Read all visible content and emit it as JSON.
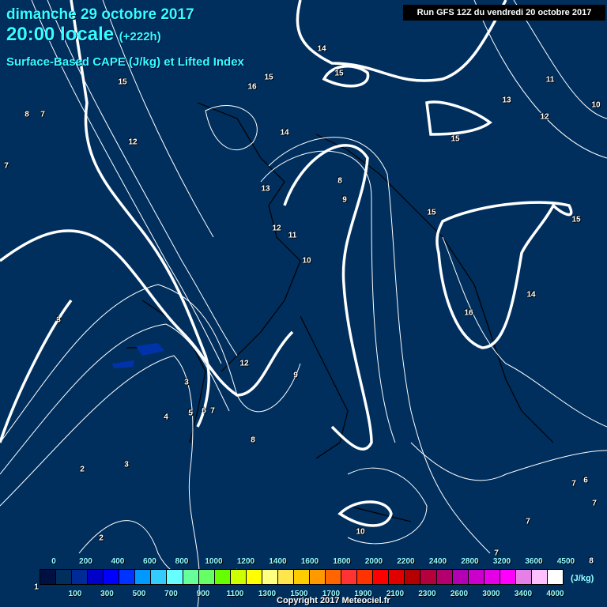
{
  "header": {
    "date": "dimanche 29 octobre 2017",
    "time": "20:00 locale",
    "offset": "(+222h)",
    "product": "Surface-Based CAPE (J/kg) et Lifted Index",
    "run": "Run GFS 12Z du vendredi 20 octobre 2017"
  },
  "lifted_index_labels": [
    "15",
    "14",
    "15",
    "16",
    "11",
    "10",
    "13",
    "12",
    "15",
    "15",
    "8",
    "7",
    "12",
    "7",
    "8",
    "13",
    "12",
    "8",
    "9",
    "15",
    "15",
    "14",
    "11",
    "12",
    "10",
    "14",
    "16",
    "3",
    "12",
    "9",
    "3",
    "4",
    "5",
    "6",
    "7",
    "8",
    "2",
    "3",
    "2",
    "10",
    "7",
    "7",
    "6",
    "7",
    "7",
    "8",
    "1"
  ],
  "legend": {
    "top_labels": [
      "0",
      "200",
      "400",
      "600",
      "800",
      "1000",
      "1200",
      "1400",
      "1600",
      "1800",
      "2000",
      "2200",
      "2400",
      "2800",
      "3200",
      "3600",
      "4500"
    ],
    "bottom_labels": [
      "100",
      "300",
      "500",
      "700",
      "900",
      "1100",
      "1300",
      "1500",
      "1700",
      "1900",
      "2100",
      "2300",
      "2600",
      "3000",
      "3400",
      "4000"
    ],
    "unit": "(J/kg)",
    "colors": [
      "#001040",
      "#002f5e",
      "#002a96",
      "#0000c8",
      "#0000ff",
      "#0033ff",
      "#0099ff",
      "#33ccff",
      "#66ffff",
      "#66ff99",
      "#66ff66",
      "#66ff00",
      "#ccff00",
      "#ffff00",
      "#ffff80",
      "#ffe64d",
      "#ffcc00",
      "#ff9900",
      "#ff6600",
      "#ff3333",
      "#ff3300",
      "#ff0000",
      "#e00000",
      "#b40000",
      "#b4003c",
      "#b4006e",
      "#b400b4",
      "#cc00cc",
      "#e600e6",
      "#ff00ff",
      "#e680e6",
      "#ffc0ff",
      "#ffffff"
    ]
  },
  "copyright": "Copyright 2017 Meteociel.fr",
  "colors": {
    "background": "#002f5e",
    "title": "#33ffff",
    "contour": "#ffffff",
    "coast": "#000000"
  }
}
